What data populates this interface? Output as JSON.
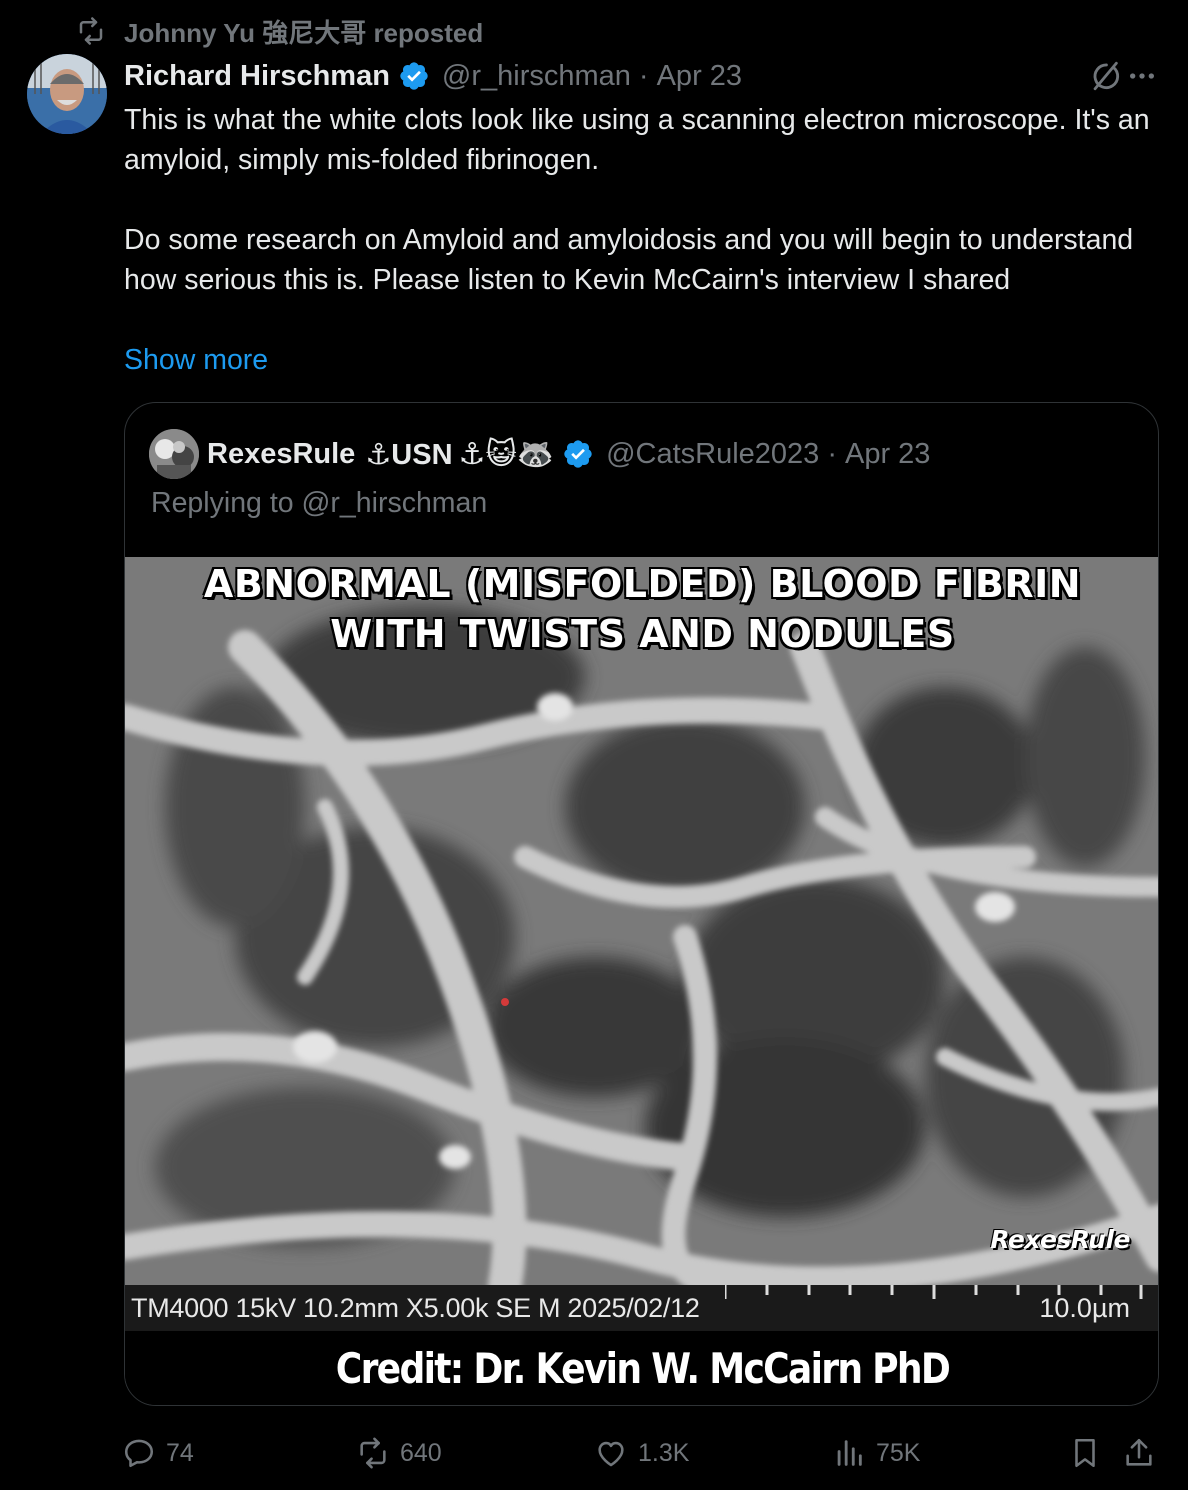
{
  "repost": {
    "icon": "repost-icon",
    "text": "Johnny Yu 強尼大哥 reposted"
  },
  "post": {
    "author_name": "Richard Hirschman",
    "handle": "@r_hirschman",
    "separator": "·",
    "date": "Apr 23",
    "text_p1": "This is what the white clots look like using a scanning electron microscope. It's an amyloid, simply mis-folded fibrinogen.",
    "text_p2": "Do some research on Amyloid and amyloidosis and you will begin to understand how serious this is. Please listen to Kevin McCairn's interview I shared",
    "show_more": "Show more"
  },
  "quote": {
    "author_name": "RexesRule",
    "name_suffix": "⚓USN",
    "emojis": "⚓😺🦝",
    "handle": "@CatsRule2023",
    "separator": "·",
    "date": "Apr 23",
    "replying_to": "Replying to @r_hirschman",
    "image": {
      "title_line1": "ABNORMAL (MISFOLDED) BLOOD FIBRIN",
      "title_line2": "WITH TWISTS AND NODULES",
      "watermark": "RexesRule",
      "scale_info": "TM4000 15kV 10.2mm X5.00k SE M 2025/02/12",
      "scale_length": "10.0µm",
      "credit": "Credit:  Dr. Kevin W. McCairn PhD"
    }
  },
  "actions": {
    "replies": "74",
    "reposts": "640",
    "likes": "1.3K",
    "views": "75K"
  },
  "colors": {
    "background": "#000000",
    "text": "#e7e9ea",
    "muted": "#71767b",
    "link": "#1d9bf0",
    "verified": "#1d9bf0",
    "border": "#2f3336"
  }
}
